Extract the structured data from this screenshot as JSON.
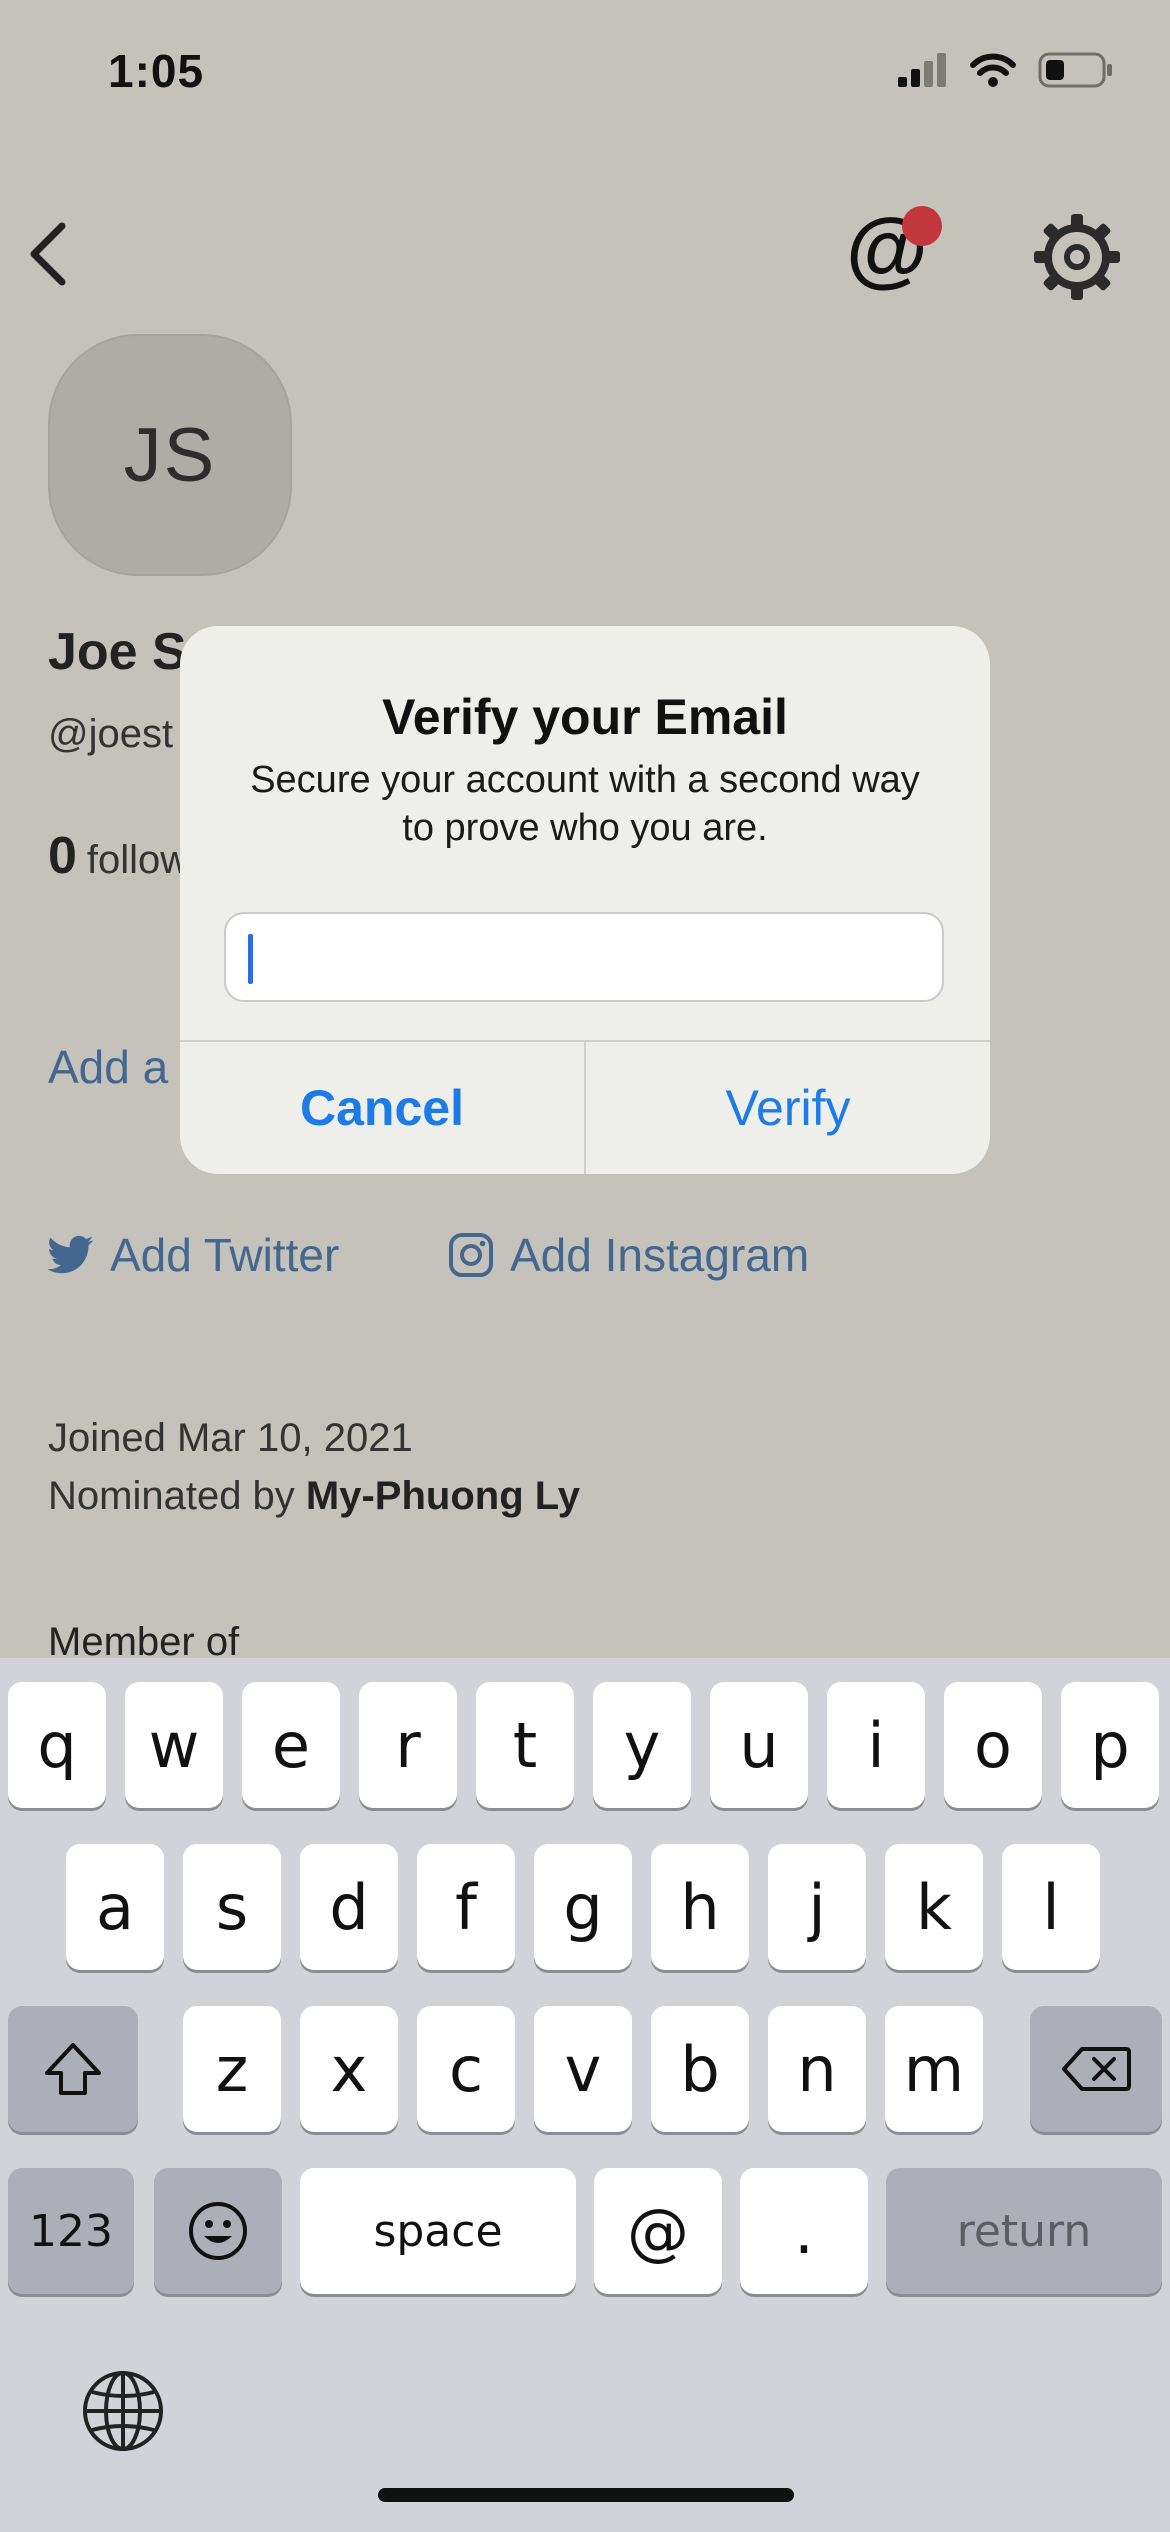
{
  "status_bar": {
    "time": "1:05",
    "icons": [
      "signal-icon",
      "wifi-icon",
      "battery-icon"
    ]
  },
  "nav": {
    "icons": [
      "chevron-left-icon",
      "at-sign-icon",
      "gear-icon"
    ],
    "mention_glyph": "@"
  },
  "profile": {
    "initials": "JS",
    "name": "Joe St",
    "handle": "@joest",
    "follower_count": "0",
    "follower_label": "follow",
    "add_bio": "Add a",
    "add_twitter": "Add Twitter",
    "add_instagram": "Add Instagram",
    "joined": "Joined Mar 10, 2021",
    "nominated_prefix": "Nominated by",
    "nominated_by": "My-Phuong Ly",
    "member_of": "Member of"
  },
  "dialog": {
    "title": "Verify your Email",
    "message": "Secure your account with a second way to prove who you are.",
    "input_value": "",
    "cancel_label": "Cancel",
    "verify_label": "Verify"
  },
  "keyboard": {
    "row1": [
      "q",
      "w",
      "e",
      "r",
      "t",
      "y",
      "u",
      "i",
      "o",
      "p"
    ],
    "row2": [
      "a",
      "s",
      "d",
      "f",
      "g",
      "h",
      "j",
      "k",
      "l"
    ],
    "row3": [
      "z",
      "x",
      "c",
      "v",
      "b",
      "n",
      "m"
    ],
    "numbers_label": "123",
    "space_label": "space",
    "at_label": "@",
    "dot_label": ".",
    "return_label": "return",
    "icons": [
      "shift-icon",
      "backspace-icon",
      "emoji-icon",
      "globe-icon"
    ]
  },
  "colors": {
    "link": "#44678f",
    "accent": "#1c7be6",
    "notification": "#c2373b",
    "backdrop": "#c4c2bb"
  }
}
